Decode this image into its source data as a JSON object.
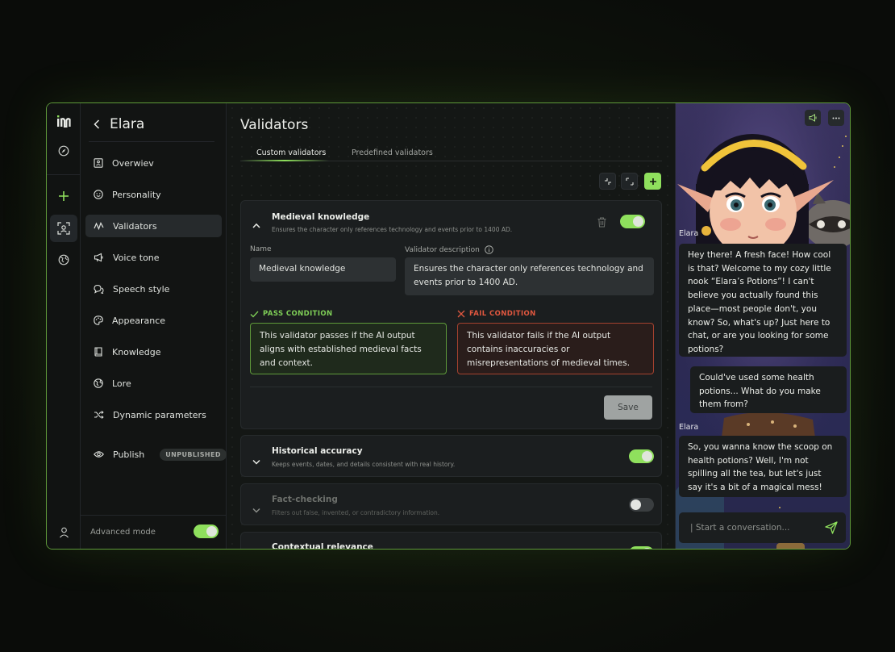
{
  "nav": {
    "back_label": "<",
    "character_name": "Elara",
    "items": [
      {
        "label": "Overwiev",
        "icon": "overview-icon"
      },
      {
        "label": "Personality",
        "icon": "smile-icon"
      },
      {
        "label": "Validators",
        "icon": "wave-icon"
      },
      {
        "label": "Voice tone",
        "icon": "megaphone-icon"
      },
      {
        "label": "Speech style",
        "icon": "speech-bubbles-icon"
      },
      {
        "label": "Appearance",
        "icon": "palette-icon"
      },
      {
        "label": "Knowledge",
        "icon": "book-icon"
      },
      {
        "label": "Lore",
        "icon": "globe-icon"
      },
      {
        "label": "Dynamic parameters",
        "icon": "shuffle-icon"
      }
    ],
    "publish_label": "Publish",
    "publish_badge": "UNPUBLISHED",
    "advanced_mode_label": "Advanced mode",
    "advanced_mode_on": true
  },
  "main": {
    "title": "Validators",
    "tabs": [
      {
        "label": "Custom validators",
        "active": true
      },
      {
        "label": "Predefined validators",
        "active": false
      }
    ],
    "expanded": {
      "title": "Medieval knowledge",
      "desc": "Ensures the character only references technology and events prior to 1400 AD.",
      "enabled": true,
      "name_label": "Name",
      "name_value": "Medieval knowledge",
      "description_label": "Validator description",
      "description_value": "Ensures the character only references technology and events prior to 1400 AD.",
      "pass_label": "PASS CONDITION",
      "pass_text": "This validator passes if the AI output aligns with established medieval facts and context.",
      "fail_label": "FAIL CONDITION",
      "fail_text": "This validator fails if the AI output contains inaccuracies or misrepresentations of medieval times.",
      "save_label": "Save"
    },
    "validators": [
      {
        "title": "Historical accuracy",
        "desc": "Keeps events, dates, and details consistent with real history.",
        "enabled": true
      },
      {
        "title": "Fact-checking",
        "desc": "Filters out false, invented, or contradictory information.",
        "enabled": false
      },
      {
        "title": "Contextual relevance",
        "desc": "",
        "enabled": true
      }
    ]
  },
  "chat": {
    "messages": [
      {
        "sender": "Elara",
        "text": "Hey there! A fresh face! How cool is that? Welcome to my cozy little nook “Elara’s Potions”! I can't believe you actually found this place—most people don't, you know? So, what's up? Just here to chat, or are you looking for some potions?"
      },
      {
        "sender": "",
        "text": "Could've used some health potions... What do you make them from?"
      },
      {
        "sender": "Elara",
        "text": "So, you wanna know the scoop on health potions? Well, I'm not spilling all the tea, but let's just say it's a bit of a magical mess!"
      }
    ],
    "input_placeholder": "| Start a conversation..."
  },
  "colors": {
    "accent": "#8fe05d",
    "fail": "#e0573f",
    "frame_border": "#5f9a3a"
  }
}
